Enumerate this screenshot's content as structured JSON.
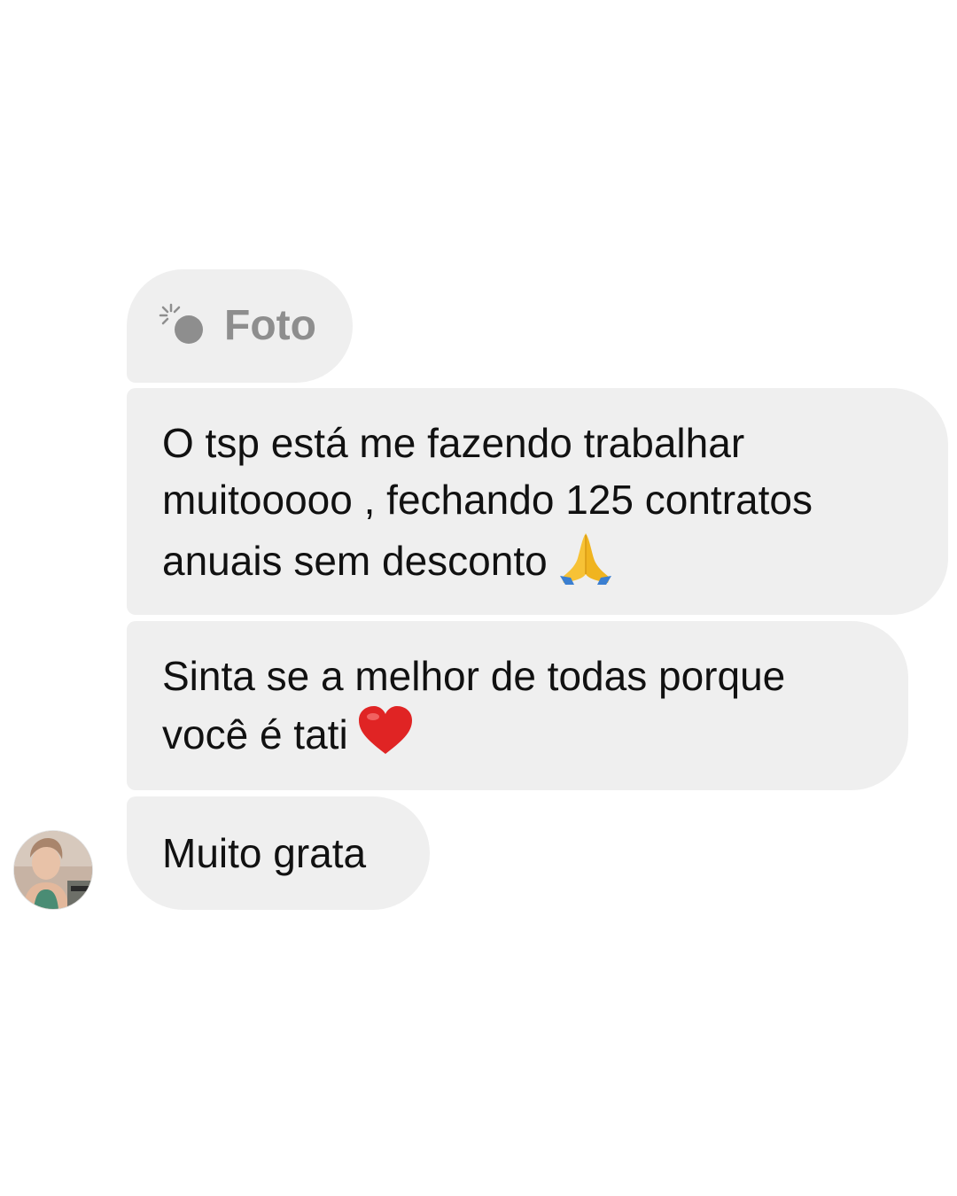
{
  "thread": {
    "photo_message": {
      "icon": "photo-flash-icon",
      "label": "Foto"
    },
    "messages": [
      {
        "lines": [
          "O tsp está me fazendo trabalhar",
          "muitooooo , fechando 125 contratos",
          "anuais sem desconto"
        ],
        "emoji": "folded-hands-emoji"
      },
      {
        "lines": [
          "Sinta se a melhor de todas porque",
          "você é  tati"
        ],
        "emoji": "red-heart-emoji"
      },
      {
        "lines": [
          "Muito grata"
        ]
      }
    ],
    "sender": {
      "avatar_icon": "sender-avatar"
    }
  },
  "colors": {
    "bubble": "#efefef",
    "text": "#111111",
    "photo_label": "#8e8e8e",
    "background": "#ffffff"
  }
}
